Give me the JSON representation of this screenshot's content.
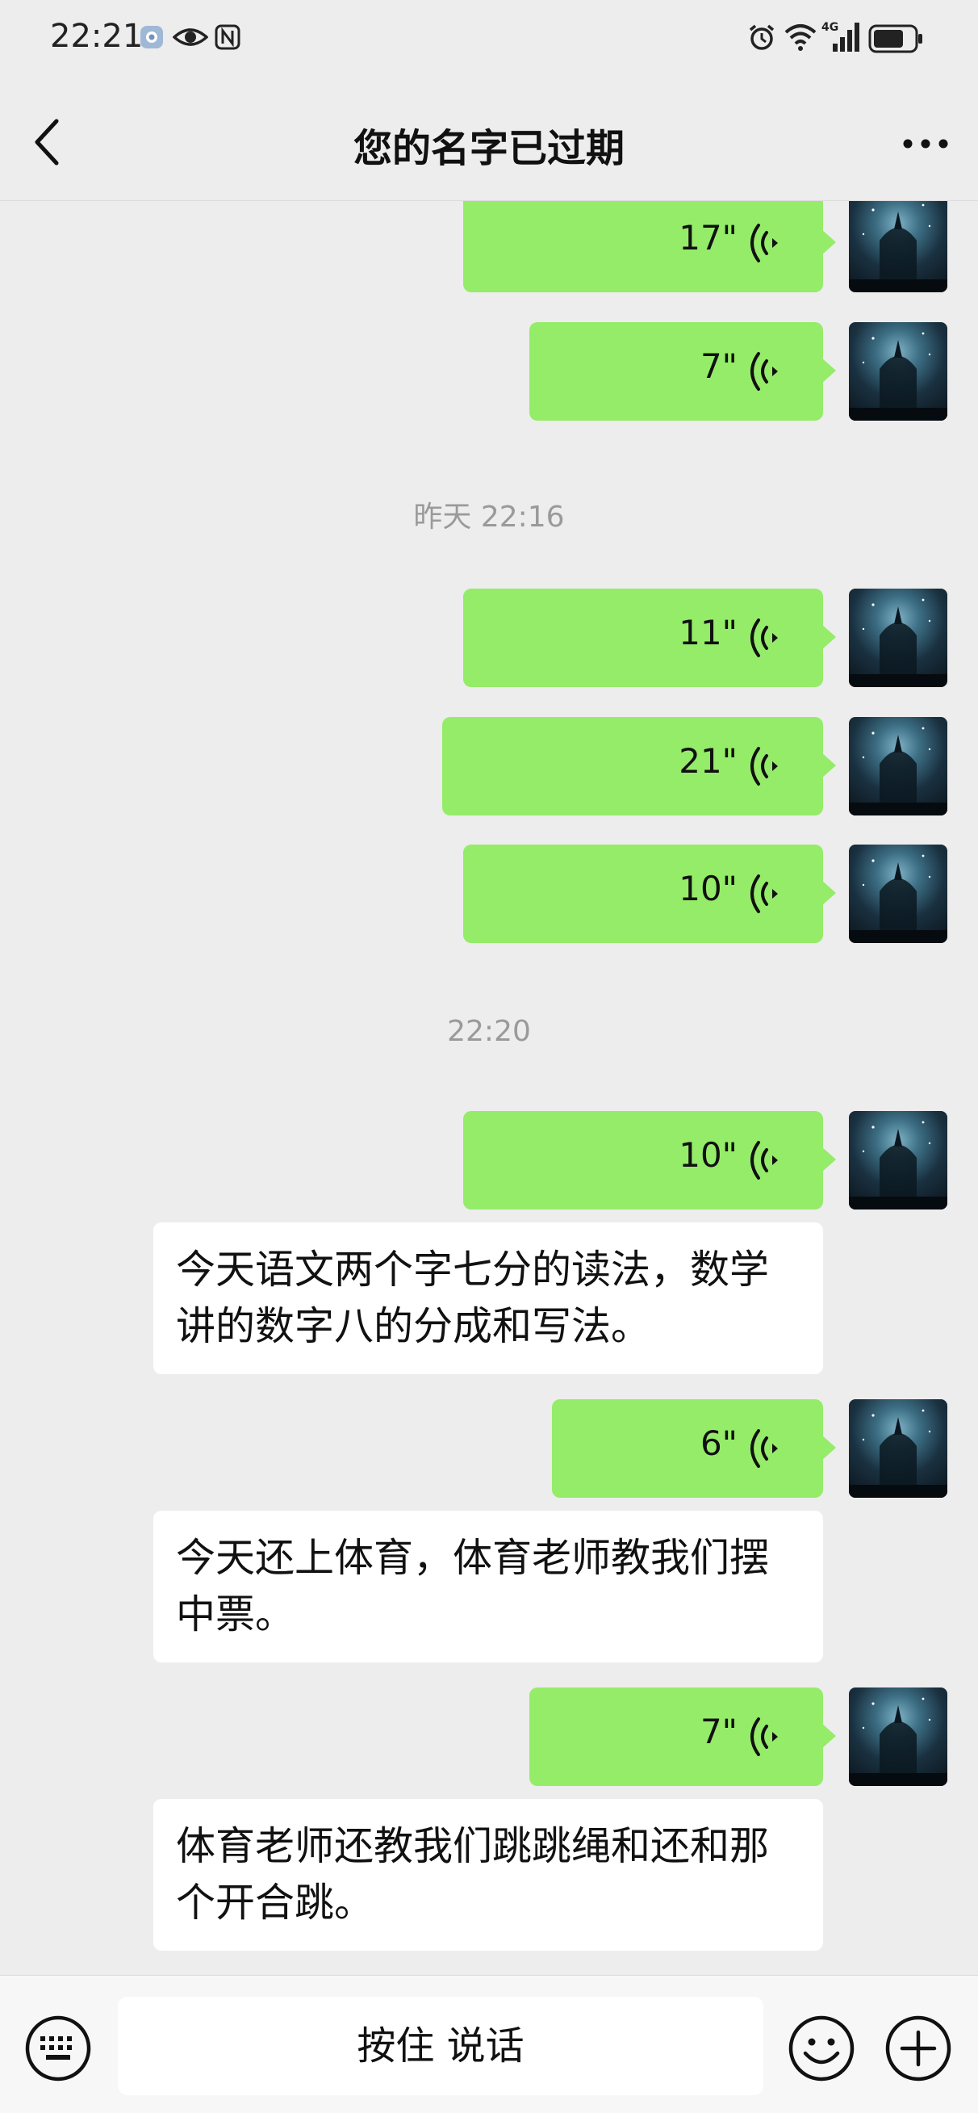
{
  "status_bar": {
    "time": "22:21",
    "left_icons": [
      "app-notification-icon",
      "eye-icon",
      "nfc-icon"
    ],
    "right_icons": [
      "alarm-icon",
      "wifi-icon",
      "4g-signal-icon",
      "battery-icon"
    ],
    "network": "4G"
  },
  "nav": {
    "title": "您的名字已过期",
    "back_icon": "chevron-left-icon",
    "more_icon": "more-icon"
  },
  "messages": [
    {
      "type": "voice",
      "side": "right",
      "duration": "17\""
    },
    {
      "type": "voice",
      "side": "right",
      "duration": "7\""
    },
    {
      "type": "timestamp",
      "text": "昨天 22:16"
    },
    {
      "type": "voice",
      "side": "right",
      "duration": "11\""
    },
    {
      "type": "voice",
      "side": "right",
      "duration": "21\""
    },
    {
      "type": "voice",
      "side": "right",
      "duration": "10\""
    },
    {
      "type": "timestamp",
      "text": "22:20"
    },
    {
      "type": "voice",
      "side": "right",
      "duration": "10\""
    },
    {
      "type": "transcript",
      "lines": [
        "今天语文两个字七分的读法，数学",
        "讲的数字八的分成和写法。"
      ]
    },
    {
      "type": "voice",
      "side": "right",
      "duration": "6\""
    },
    {
      "type": "transcript",
      "lines": [
        "今天还上体育，体育老师教我们摆",
        "中票。"
      ]
    },
    {
      "type": "voice",
      "side": "right",
      "duration": "7\""
    },
    {
      "type": "transcript",
      "lines": [
        "体育老师还教我们跳跳绳和还和那",
        "个开合跳。"
      ]
    }
  ],
  "bottom_bar": {
    "hold_to_talk": "按住 说话",
    "keyboard_icon": "keyboard-icon",
    "emoji_icon": "emoji-icon",
    "plus_icon": "plus-icon"
  },
  "colors": {
    "voice_bubble": "#95ec69",
    "background": "#ededed",
    "text_bubble": "#ffffff"
  }
}
